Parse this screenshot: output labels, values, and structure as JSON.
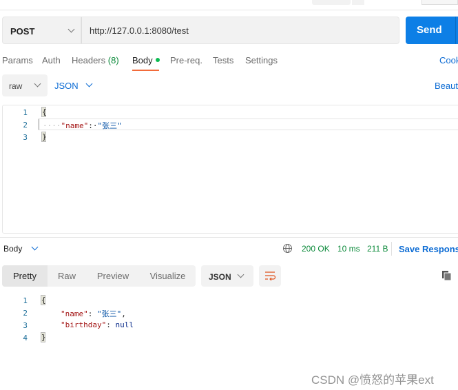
{
  "request": {
    "method": "POST",
    "url": "http://127.0.0.1:8080/test",
    "send_label": "Send"
  },
  "tabs": [
    {
      "label": "Params"
    },
    {
      "label": "Auth"
    },
    {
      "label": "Headers",
      "count": "(8)"
    },
    {
      "label": "Body",
      "active": true
    },
    {
      "label": "Pre-req."
    },
    {
      "label": "Tests"
    },
    {
      "label": "Settings"
    }
  ],
  "cookies_label": "Cook",
  "body_mode": {
    "type": "raw",
    "format": "JSON",
    "beautify_label": "Beaut"
  },
  "request_body": {
    "lines": [
      "1",
      "2",
      "3"
    ],
    "open": "{",
    "indent": "····",
    "key": "\"name\"",
    "colon": ":·",
    "value": "\"张三\"",
    "close": "}"
  },
  "response": {
    "label": "Body",
    "status": "200 OK",
    "time": "10 ms",
    "size": "211 B",
    "save_label": "Save Response",
    "views": [
      "Pretty",
      "Raw",
      "Preview",
      "Visualize"
    ],
    "active_view": "Pretty",
    "format": "JSON",
    "lines": [
      "1",
      "2",
      "3",
      "4"
    ],
    "open": "{",
    "k1": "\"name\"",
    "v1": "\"张三\"",
    "k2": "\"birthday\"",
    "v2": "null",
    "close": "}"
  },
  "watermark": "CSDN @愤怒的苹果ext",
  "colors": {
    "accent": "#0d7fe6",
    "tab_underline": "#f26b3a",
    "status_ok": "#0b8a3a",
    "link": "#0d6cd4"
  }
}
